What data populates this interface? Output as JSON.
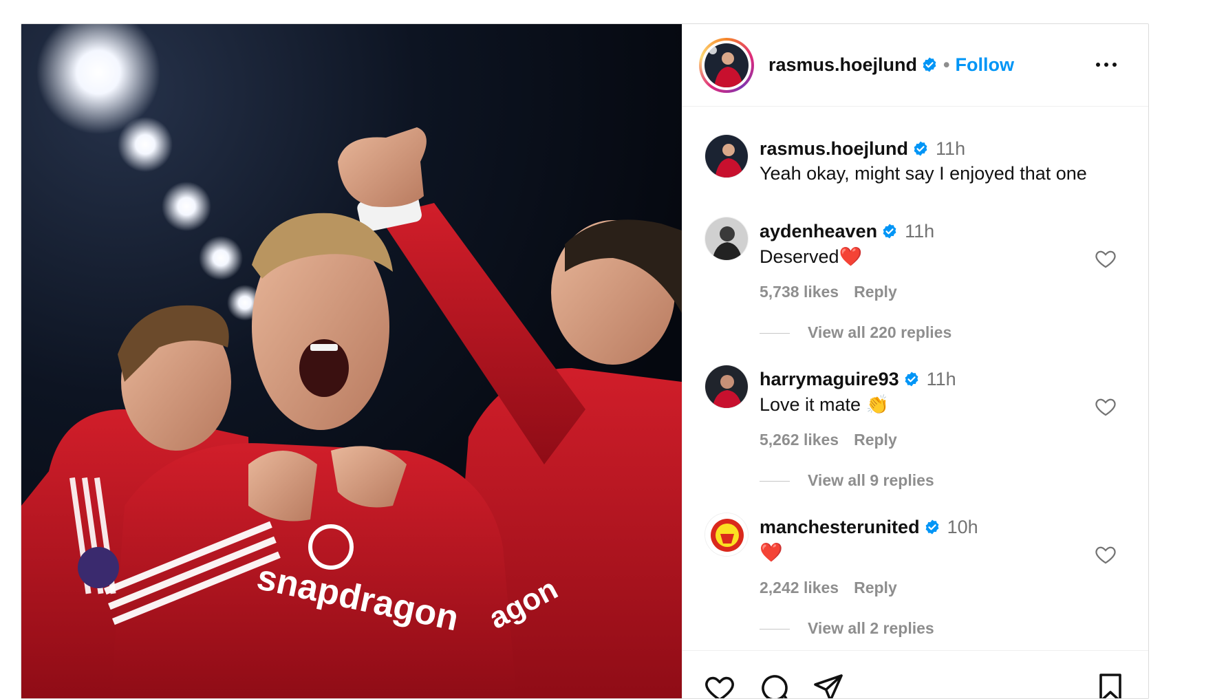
{
  "post": {
    "author": "rasmus.hoejlund",
    "follow_label": "Follow",
    "separator": "•"
  },
  "caption": {
    "user": "rasmus.hoejlund",
    "time": "11h",
    "text": "Yeah okay, might say I enjoyed that one"
  },
  "comments": [
    {
      "user": "aydenheaven",
      "time": "11h",
      "text": "Deserved",
      "emoji": "❤️",
      "likes": "5,738 likes",
      "reply_label": "Reply",
      "view_replies": "View all 220 replies"
    },
    {
      "user": "harrymaguire93",
      "time": "11h",
      "text": "Love it mate",
      "emoji": "👏",
      "likes": "5,262 likes",
      "reply_label": "Reply",
      "view_replies": "View all 9 replies"
    },
    {
      "user": "manchesterunited",
      "time": "10h",
      "text": "",
      "emoji": "❤️",
      "likes": "2,242 likes",
      "reply_label": "Reply",
      "view_replies": "View all 2 replies"
    }
  ],
  "photo": {
    "sponsor_text": "snapdragon",
    "sponsor_text_right": "agon"
  },
  "colors": {
    "accent": "#0095f6",
    "verified": "#0095f6",
    "kit_red": "#c8102e",
    "muted": "#8e8e8e"
  },
  "icons": {
    "like": "heart-icon",
    "comment": "comment-bubble-icon",
    "share": "paper-plane-icon",
    "save": "bookmark-icon",
    "more": "more-horizontal-icon",
    "verified": "verified-badge-icon"
  }
}
